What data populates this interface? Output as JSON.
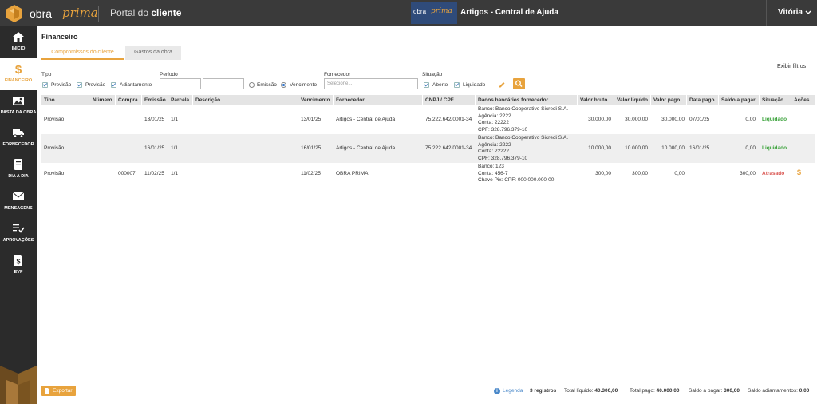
{
  "header": {
    "logo_obra": "obra",
    "logo_prima": "prima",
    "portal_prefix": "Portal do",
    "portal_bold": "cliente",
    "brand_obra": "obra",
    "brand_prima": "prima",
    "title": "Artigos - Central de Ajuda",
    "user": "Vitória"
  },
  "sidebar": {
    "items": [
      {
        "label": "INÍCIO",
        "icon": "home-icon"
      },
      {
        "label": "FINANCEIRO",
        "icon": "dollar-icon"
      },
      {
        "label": "PASTA DA OBRA",
        "icon": "image-icon"
      },
      {
        "label": "FORNECEDOR",
        "icon": "truck-icon"
      },
      {
        "label": "DIA A DIA",
        "icon": "notebook-icon"
      },
      {
        "label": "MENSAGENS",
        "icon": "envelope-icon"
      },
      {
        "label": "APROVAÇÕES",
        "icon": "checklist-icon"
      },
      {
        "label": "EVF",
        "icon": "document-dollar-icon"
      }
    ]
  },
  "page": {
    "title": "Financeiro",
    "tabs": [
      "Compromissos do cliente",
      "Gastos da obra"
    ],
    "exibir_filtros": "Exibir filtros"
  },
  "filters": {
    "tipo_label": "Tipo",
    "tipo_options": [
      "Previsão",
      "Provisão",
      "Adiantamento"
    ],
    "periodo_label": "Período",
    "periodo_options": [
      "Emissão",
      "Vencimento"
    ],
    "fornecedor_label": "Fornecedor",
    "fornecedor_placeholder": "Selecione...",
    "situacao_label": "Situação",
    "situacao_options": [
      "Aberto",
      "Liquidado"
    ]
  },
  "table": {
    "columns": [
      "Tipo",
      "Número",
      "Compra",
      "Emissão",
      "Parcela",
      "Descrição",
      "Vencimento",
      "Fornecedor",
      "CNPJ / CPF",
      "Dados bancários fornecedor",
      "Valor bruto",
      "Valor líquido",
      "Valor pago",
      "Data pago",
      "Saldo a pagar",
      "Situação",
      "Ações"
    ],
    "rows": [
      {
        "tipo": "Provisão",
        "numero": "",
        "compra": "",
        "emissao": "13/01/25",
        "parcela": "1/1",
        "descricao": "",
        "vencimento": "13/01/25",
        "fornecedor": "Artigos - Central de Ajuda",
        "cnpj": "75.222.642/0001-34",
        "banco": [
          "Banco: Banco Cooperativo Sicredi S.A.",
          "Agência: 2222",
          "Conta: 22222",
          "CPF: 328.796.379-10"
        ],
        "valor_bruto": "30.000,00",
        "valor_liquido": "30.000,00",
        "valor_pago": "30.000,00",
        "data_pago": "07/01/25",
        "saldo": "0,00",
        "situacao": "Liquidado",
        "acao": ""
      },
      {
        "tipo": "Provisão",
        "numero": "",
        "compra": "",
        "emissao": "16/01/25",
        "parcela": "1/1",
        "descricao": "",
        "vencimento": "16/01/25",
        "fornecedor": "Artigos - Central de Ajuda",
        "cnpj": "75.222.642/0001-34",
        "banco": [
          "Banco: Banco Cooperativo Sicredi S.A.",
          "Agência: 2222",
          "Conta: 22222",
          "CPF: 328.796.379-10"
        ],
        "valor_bruto": "10.000,00",
        "valor_liquido": "10.000,00",
        "valor_pago": "10.000,00",
        "data_pago": "16/01/25",
        "saldo": "0,00",
        "situacao": "Liquidado",
        "acao": ""
      },
      {
        "tipo": "Provisão",
        "numero": "",
        "compra": "000007",
        "emissao": "11/02/25",
        "parcela": "1/1",
        "descricao": "",
        "vencimento": "11/02/25",
        "fornecedor": "OBRA PRIMA",
        "cnpj": "",
        "banco": [
          "Banco: 123",
          "Conta: 456-7",
          "Chave Pix: CPF: 000.000.000-00"
        ],
        "valor_bruto": "300,00",
        "valor_liquido": "300,00",
        "valor_pago": "0,00",
        "data_pago": "",
        "saldo": "300,00",
        "situacao": "Atrasado",
        "acao": "$"
      }
    ]
  },
  "footer": {
    "export": "Exportar",
    "legenda": "Legenda",
    "registros": "3 registros",
    "total_liquido_label": "Total líquido:",
    "total_liquido": "40.300,00",
    "total_pago_label": "Total pago:",
    "total_pago": "40.000,00",
    "saldo_label": "Saldo a pagar:",
    "saldo": "300,00",
    "saldo_adiant_label": "Saldo adiantamentos:",
    "saldo_adiant": "0,00"
  },
  "colors": {
    "accent": "#e8a33d",
    "topbar": "#3a3a3a",
    "sidebar": "#2b2b2b",
    "liquidado": "#3aa23a",
    "atrasado": "#d9534f"
  }
}
